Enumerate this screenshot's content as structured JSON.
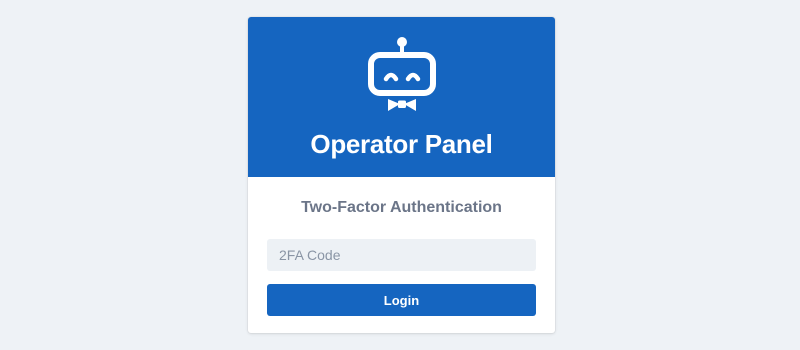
{
  "header": {
    "logo_icon": "robot-bowtie-icon",
    "title": "Operator Panel"
  },
  "form": {
    "subtitle": "Two-Factor Authentication",
    "code_input": {
      "placeholder": "2FA Code",
      "value": ""
    },
    "submit_label": "Login"
  },
  "colors": {
    "brand": "#1565c0",
    "page_background": "#eef2f6",
    "subtitle": "#6b7588",
    "input_background": "#edf1f5"
  }
}
